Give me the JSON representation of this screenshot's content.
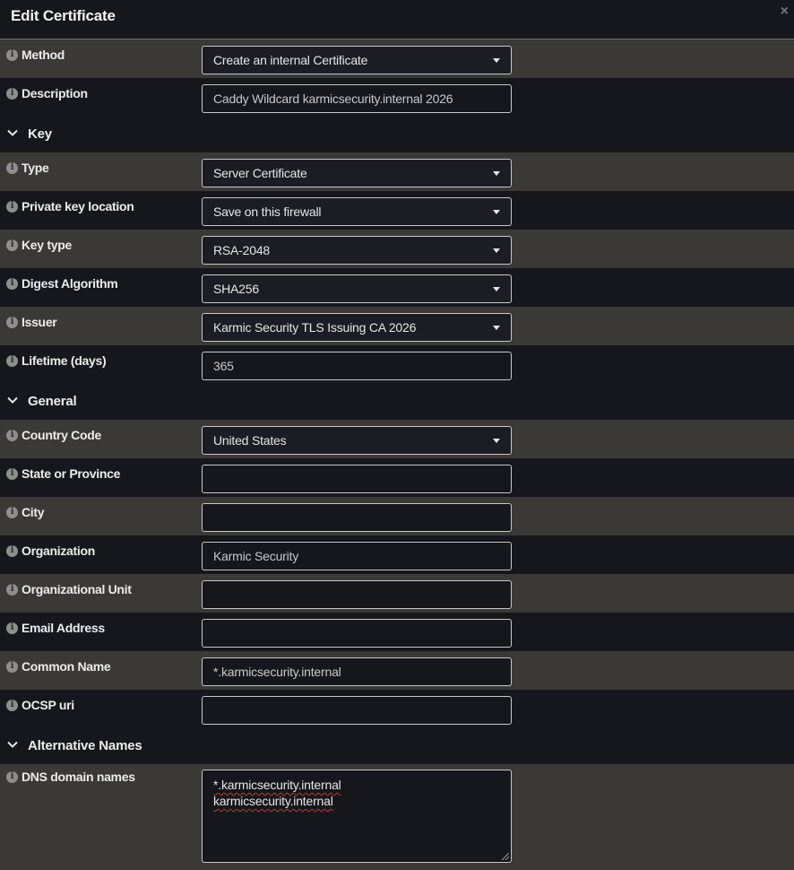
{
  "dialog": {
    "title": "Edit Certificate",
    "close_glyph": "×"
  },
  "info_glyph": "i",
  "rows": {
    "method": {
      "label": "Method",
      "value": "Create an internal Certificate"
    },
    "description": {
      "label": "Description",
      "value": "Caddy Wildcard karmicsecurity.internal 2026"
    },
    "type": {
      "label": "Type",
      "value": "Server Certificate"
    },
    "private_key_location": {
      "label": "Private key location",
      "value": "Save on this firewall"
    },
    "key_type": {
      "label": "Key type",
      "value": "RSA-2048"
    },
    "digest_algorithm": {
      "label": "Digest Algorithm",
      "value": "SHA256"
    },
    "issuer": {
      "label": "Issuer",
      "value": "Karmic Security TLS Issuing CA 2026"
    },
    "lifetime": {
      "label": "Lifetime (days)",
      "value": "365"
    },
    "country_code": {
      "label": "Country Code",
      "value": "United States"
    },
    "state": {
      "label": "State or Province",
      "value": ""
    },
    "city": {
      "label": "City",
      "value": ""
    },
    "organization": {
      "label": "Organization",
      "value": "Karmic Security"
    },
    "org_unit": {
      "label": "Organizational Unit",
      "value": ""
    },
    "email": {
      "label": "Email Address",
      "value": ""
    },
    "common_name": {
      "label": "Common Name",
      "value": "*.karmicsecurity.internal"
    },
    "ocsp_uri": {
      "label": "OCSP uri",
      "value": ""
    },
    "dns_names": {
      "label": "DNS domain names",
      "lines": [
        "*.karmicsecurity.internal",
        "karmicsecurity.internal"
      ]
    }
  },
  "sections": {
    "key": "Key",
    "general": "General",
    "alt_names": "Alternative Names"
  }
}
